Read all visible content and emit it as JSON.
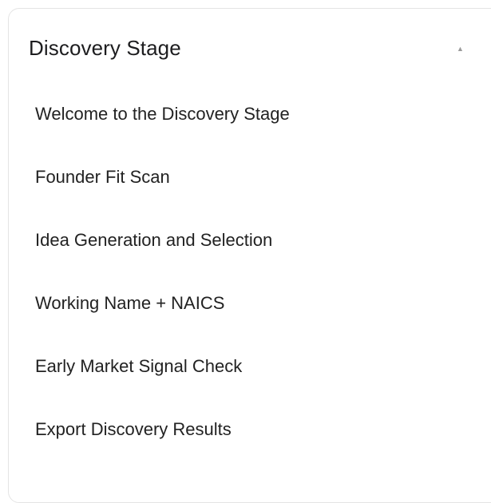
{
  "section": {
    "title": "Discovery Stage",
    "caret_icon": "caret-up-icon",
    "expanded": true,
    "items": [
      {
        "label": "Welcome to the Discovery Stage"
      },
      {
        "label": "Founder Fit Scan"
      },
      {
        "label": "Idea Generation and Selection"
      },
      {
        "label": "Working Name + NAICS"
      },
      {
        "label": "Early Market Signal Check"
      },
      {
        "label": "Export Discovery Results"
      }
    ]
  },
  "colors": {
    "border": "#e4e4e4",
    "title_text": "#1d1d1f",
    "item_text": "#222222",
    "caret": "#9a9a9a"
  }
}
